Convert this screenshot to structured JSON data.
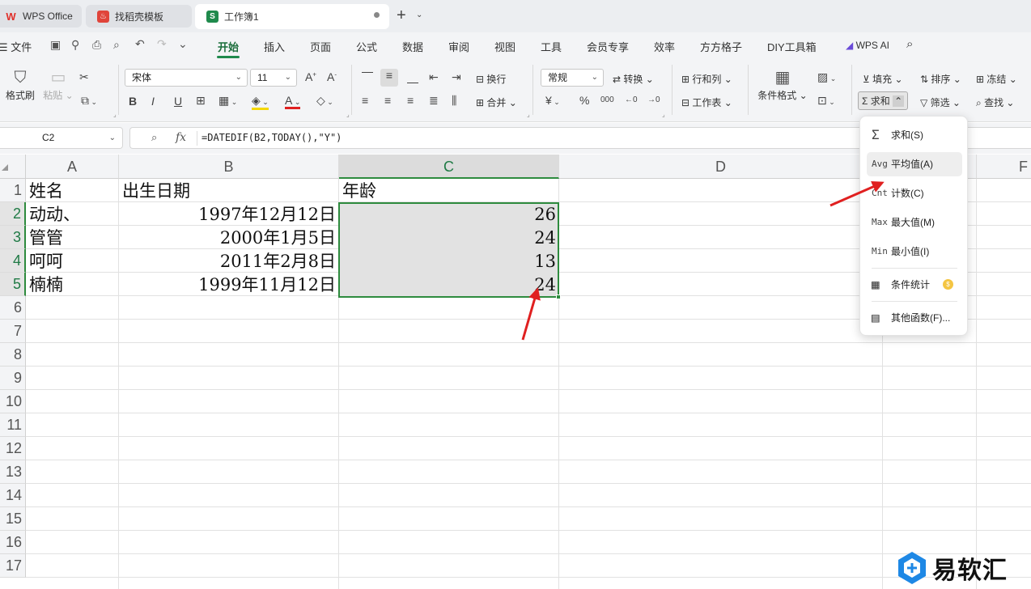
{
  "titlebar": {
    "tabs": [
      {
        "label": "WPS Office",
        "icon": "wps-logo-icon"
      },
      {
        "label": "找稻壳模板",
        "icon": "docer-icon"
      },
      {
        "label": "工作簿1",
        "icon": "spreadsheet-s-icon",
        "icon_letter": "S",
        "active": true
      }
    ],
    "new_tab": "+"
  },
  "menubar": {
    "file": "文件",
    "items": [
      "开始",
      "插入",
      "页面",
      "公式",
      "数据",
      "审阅",
      "视图",
      "工具",
      "会员专享",
      "效率",
      "方方格子",
      "DIY工具箱"
    ],
    "active": "开始",
    "wps_ai": "WPS AI"
  },
  "ribbon": {
    "format_painter": "格式刷",
    "paste": "粘贴",
    "font_name": "宋体",
    "font_size": "11",
    "wrap": "换行",
    "merge": "合并",
    "number_format": "常规",
    "convert": "转换",
    "rows_cols": "行和列",
    "worksheet": "工作表",
    "conditional_format": "条件格式",
    "fill": "填充",
    "sort": "排序",
    "freeze": "冻结",
    "sum": "求和",
    "filter": "筛选",
    "find": "查找",
    "bold": "B",
    "italic": "I",
    "underline": "U",
    "currency": "¥",
    "percent": "%",
    "thousands": "000"
  },
  "formula_bar": {
    "name_box": "C2",
    "fx": "fx",
    "formula": "=DATEDIF(B2,TODAY(),\"Y\")"
  },
  "grid": {
    "columns": [
      "A",
      "B",
      "C",
      "D",
      "F"
    ],
    "rows": [
      "1",
      "2",
      "3",
      "4",
      "5",
      "6",
      "7",
      "8",
      "9",
      "10",
      "11",
      "12",
      "13",
      "14",
      "15",
      "16",
      "17"
    ],
    "cells": {
      "A1": "姓名",
      "B1": "出生日期",
      "C1": "年龄",
      "A2": "动动、",
      "B2": "1997年12月12日",
      "C2": "26",
      "A3": "管管",
      "B3": "2000年1月5日",
      "C3": "24",
      "A4": "呵呵",
      "B4": "2011年2月8日",
      "C4": "13",
      "A5": "楠楠",
      "B5": "1999年11月12日",
      "C5": "24"
    },
    "selection_color": "#2e8b3e"
  },
  "sum_dropdown": {
    "items": [
      {
        "icon": "Σ",
        "label": "求和(S)"
      },
      {
        "icon": "Avg",
        "label": "平均值(A)"
      },
      {
        "icon": "Cnt",
        "label": "计数(C)"
      },
      {
        "icon": "Max",
        "label": "最大值(M)"
      },
      {
        "icon": "Min",
        "label": "最小值(I)"
      },
      {
        "icon": "▦",
        "label": "条件统计"
      },
      {
        "icon": "▤",
        "label": "其他函数(F)..."
      }
    ]
  },
  "watermark": {
    "text": "易软汇"
  },
  "colors": {
    "accent": "#1f8a4c",
    "annotation_arrow": "#e02020"
  }
}
